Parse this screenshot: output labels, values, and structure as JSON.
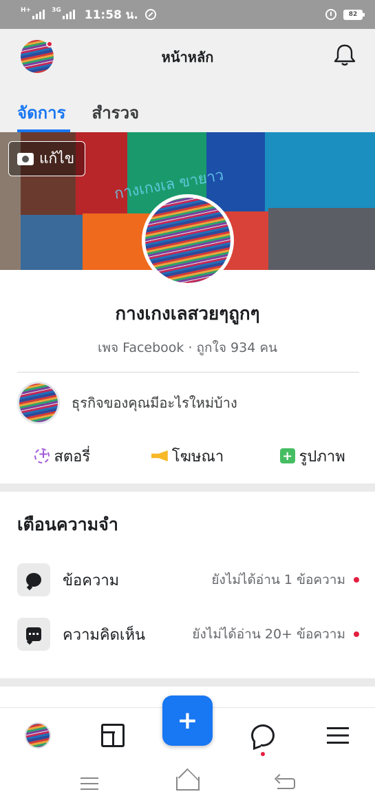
{
  "status_bar": {
    "network": "H+",
    "network2": "3G",
    "time": "11:58 น.",
    "battery": "82"
  },
  "header": {
    "title": "หน้าหลัก"
  },
  "tabs": [
    {
      "label": "จัดการ",
      "active": true
    },
    {
      "label": "สำรวจ",
      "active": false
    }
  ],
  "cover": {
    "edit_label": "แก้ไข",
    "watermark": "กางเกงเล ขายาว"
  },
  "page": {
    "name": "กางเกงเลสวยๆถูกๆ",
    "meta": "เพจ Facebook · ถูกใจ 934 คน"
  },
  "composer": {
    "prompt": "ธุรกิจของคุณมีอะไรใหม่บ้าง"
  },
  "actions": [
    {
      "label": "สตอรี่",
      "icon": "story-icon"
    },
    {
      "label": "โฆษณา",
      "icon": "megaphone-icon"
    },
    {
      "label": "รูปภาพ",
      "icon": "photo-icon"
    }
  ],
  "reminders": {
    "title": "เตือนความจำ",
    "items": [
      {
        "label": "ข้อความ",
        "status": "ยังไม่ได้อ่าน 1 ข้อความ",
        "icon": "message-icon"
      },
      {
        "label": "ความคิดเห็น",
        "status": "ยังไม่ได้อ่าน 20+ ข้อความ",
        "icon": "comment-icon"
      }
    ]
  },
  "bottom_nav": {
    "fab_label": "+"
  },
  "colors": {
    "accent": "#1877f2",
    "notification": "#e41e3f"
  }
}
